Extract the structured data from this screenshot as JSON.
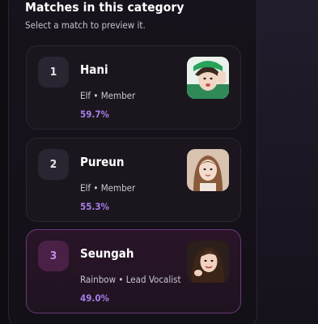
{
  "header": {
    "title": "Matches in this category",
    "subtitle": "Select a match to preview it."
  },
  "matches": [
    {
      "rank": "1",
      "name": "Hani",
      "meta": "Elf • Member",
      "percent": "59.7%",
      "selected": false,
      "avatar_icon": "hani-photo"
    },
    {
      "rank": "2",
      "name": "Pureun",
      "meta": "Elf • Member",
      "percent": "55.3%",
      "selected": false,
      "avatar_icon": "pureun-photo"
    },
    {
      "rank": "3",
      "name": "Seungah",
      "meta": "Rainbow • Lead Vocalist",
      "percent": "49.0%",
      "selected": true,
      "avatar_icon": "seungah-photo"
    }
  ],
  "colors": {
    "accent": "#a77de6",
    "selected_border": "#6b3a7a",
    "selected_rank_bg": "#4a2046",
    "card_bg": "#1b161e"
  }
}
